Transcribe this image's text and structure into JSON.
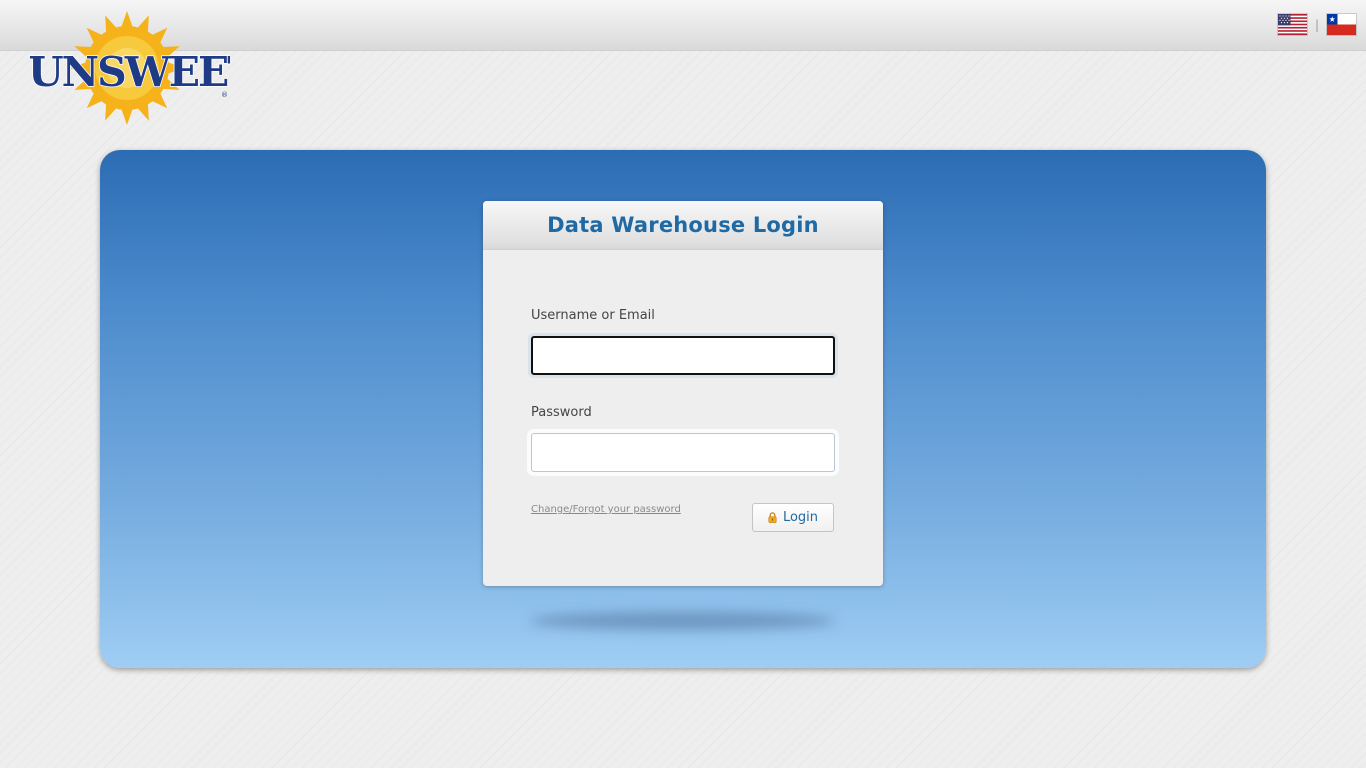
{
  "brand": {
    "logo_text": "SUNSWEET",
    "colors": {
      "navy": "#1f3b85",
      "sun": "#f5b21b",
      "sun_center": "#f7c93c"
    }
  },
  "header": {
    "languages": [
      {
        "icon": "us-flag-icon",
        "lang": "English"
      },
      {
        "icon": "chile-flag-icon",
        "lang": "Español"
      }
    ],
    "separator": "|"
  },
  "login": {
    "title": "Data Warehouse Login",
    "username_label": "Username or Email",
    "username_value": "",
    "password_label": "Password",
    "password_value": "",
    "forgot_link": "Change/Forgot your password",
    "submit_label": "Login",
    "submit_icon": "lock-icon"
  },
  "colors": {
    "panel_top": "#2c6cb3",
    "panel_bottom": "#9fcdf4",
    "title": "#1f6aa5",
    "card_bg": "#eeeeee"
  }
}
